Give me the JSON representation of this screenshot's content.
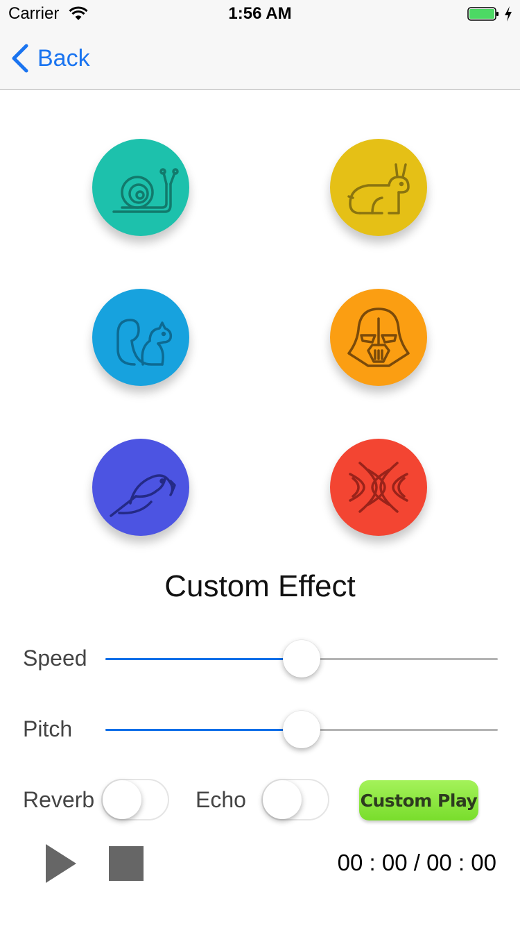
{
  "status_bar": {
    "carrier": "Carrier",
    "time": "1:56 AM"
  },
  "nav": {
    "back_label": "Back"
  },
  "effects": [
    {
      "name": "snail",
      "color": "#1dc1ac"
    },
    {
      "name": "rabbit",
      "color": "#e5c016"
    },
    {
      "name": "squirrel",
      "color": "#17a2de"
    },
    {
      "name": "darth-vader",
      "color": "#fb9e12"
    },
    {
      "name": "parrot",
      "color": "#4c54e2"
    },
    {
      "name": "reverb-waves",
      "color": "#f34532"
    }
  ],
  "custom": {
    "title": "Custom Effect",
    "speed_label": "Speed",
    "speed_value": 0.5,
    "pitch_label": "Pitch",
    "pitch_value": 0.5,
    "reverb_label": "Reverb",
    "reverb_on": false,
    "echo_label": "Echo",
    "echo_on": false,
    "custom_play_label": "Custom Play"
  },
  "player": {
    "time_display": "00 : 00 / 00 : 00"
  },
  "colors": {
    "accent": "#1a74f0",
    "slider_fill": "#0f6ee8",
    "custom_play": "#8ce844"
  }
}
